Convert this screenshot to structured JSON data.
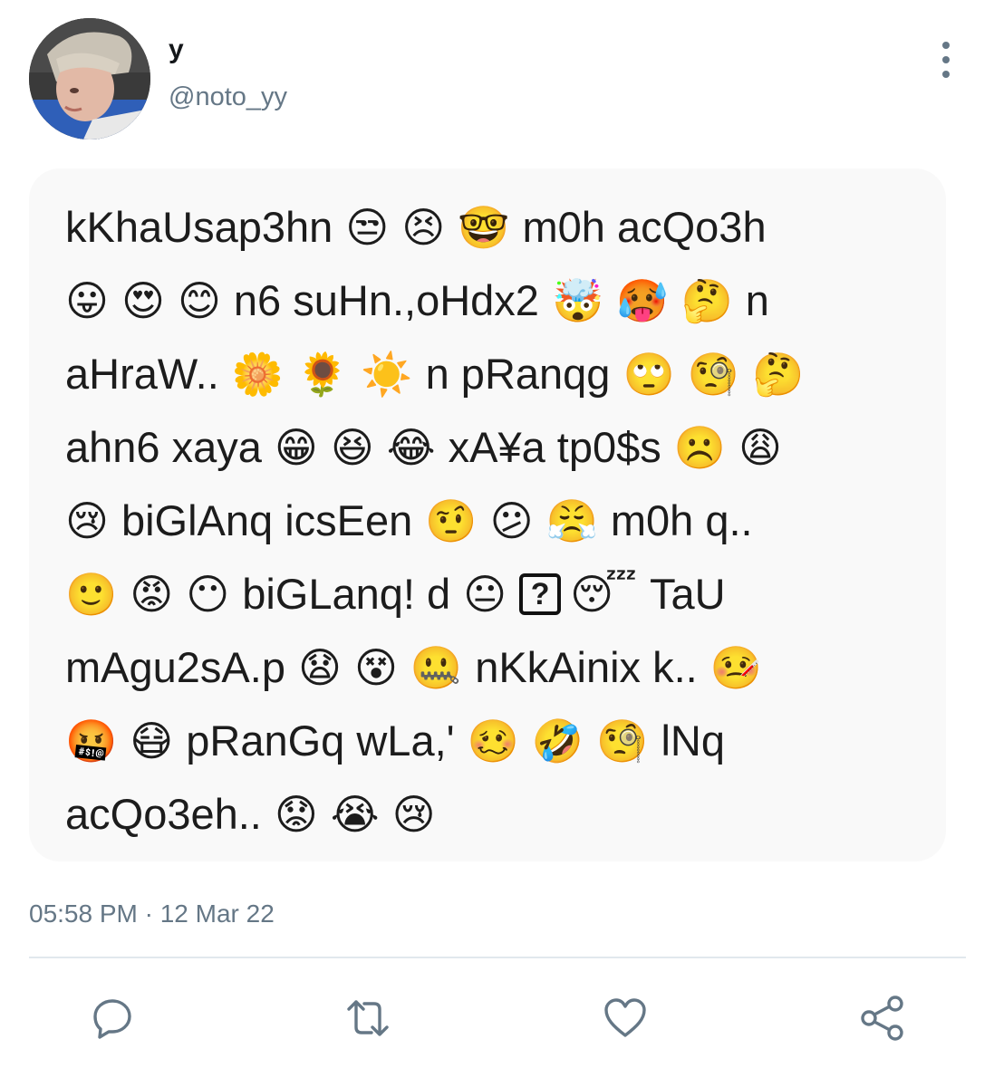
{
  "author": {
    "display_name": "y",
    "handle": "@noto_yy"
  },
  "tweet_image": {
    "lines": [
      [
        {
          "t": "w",
          "v": "kKhaUsap3hn"
        },
        {
          "t": "e",
          "v": "😒"
        },
        {
          "t": "e",
          "v": "😣"
        },
        {
          "t": "e",
          "v": "🤓"
        },
        {
          "t": "w",
          "v": "m0h acQo3h"
        }
      ],
      [
        {
          "t": "e",
          "v": "😛"
        },
        {
          "t": "e",
          "v": "😍"
        },
        {
          "t": "e",
          "v": "😊"
        },
        {
          "t": "w",
          "v": "n6 suHn.,oHdx2"
        },
        {
          "t": "e",
          "v": "🤯"
        },
        {
          "t": "e",
          "v": "🥵"
        },
        {
          "t": "e",
          "v": "🤔"
        },
        {
          "t": "w",
          "v": "n"
        }
      ],
      [
        {
          "t": "w",
          "v": "aHraW.."
        },
        {
          "t": "e",
          "v": "🌼"
        },
        {
          "t": "e",
          "v": "🌻"
        },
        {
          "t": "e",
          "v": "☀️"
        },
        {
          "t": "w",
          "v": "n pRanqg"
        },
        {
          "t": "e",
          "v": "🙄"
        },
        {
          "t": "e",
          "v": "🧐"
        },
        {
          "t": "e",
          "v": "🤔"
        }
      ],
      [
        {
          "t": "w",
          "v": "ahn6 xaya"
        },
        {
          "t": "e",
          "v": "😁"
        },
        {
          "t": "e",
          "v": "😆"
        },
        {
          "t": "e",
          "v": "😂"
        },
        {
          "t": "w",
          "v": "xA¥a tp0$s"
        },
        {
          "t": "e",
          "v": "☹️"
        },
        {
          "t": "e",
          "v": "😩"
        }
      ],
      [
        {
          "t": "e",
          "v": "😢"
        },
        {
          "t": "w",
          "v": "biGlAnq icsEen"
        },
        {
          "t": "e",
          "v": "🤨"
        },
        {
          "t": "e",
          "v": "😕"
        },
        {
          "t": "e",
          "v": "😤"
        },
        {
          "t": "w",
          "v": "m0h q.."
        }
      ],
      [
        {
          "t": "e",
          "v": "🙂"
        },
        {
          "t": "e",
          "v": "😡"
        },
        {
          "t": "e",
          "v": "😶"
        },
        {
          "t": "w",
          "v": "biGLanq! d"
        },
        {
          "t": "e",
          "v": "😐"
        },
        {
          "t": "b",
          "v": "?"
        },
        {
          "t": "e",
          "v": "😴"
        },
        {
          "t": "w",
          "v": "TaU"
        }
      ],
      [
        {
          "t": "w",
          "v": "mAgu2sA.p"
        },
        {
          "t": "e",
          "v": "😧"
        },
        {
          "t": "e",
          "v": "😵"
        },
        {
          "t": "e",
          "v": "🤐"
        },
        {
          "t": "w",
          "v": "nKkAinix k.."
        },
        {
          "t": "e",
          "v": "🤒"
        }
      ],
      [
        {
          "t": "e",
          "v": "🤬"
        },
        {
          "t": "e",
          "v": "😷"
        },
        {
          "t": "w",
          "v": "pRanGq wLa,'"
        },
        {
          "t": "e",
          "v": "🥴"
        },
        {
          "t": "e",
          "v": "🤣"
        },
        {
          "t": "e",
          "v": "🧐"
        },
        {
          "t": "w",
          "v": "lNq"
        }
      ],
      [
        {
          "t": "w",
          "v": "acQo3eh.."
        },
        {
          "t": "e",
          "v": "😟"
        },
        {
          "t": "e",
          "v": "😭"
        },
        {
          "t": "e",
          "v": "😢"
        }
      ]
    ]
  },
  "timestamp": "05:58 PM · 12 Mar 22",
  "actions": {
    "reply": "reply-icon",
    "retweet": "retweet-icon",
    "like": "heart-icon",
    "share": "share-icon"
  },
  "colors": {
    "text_primary": "#14171a",
    "text_secondary": "#657786",
    "divider": "#e1e8ed",
    "card_bg": "#f9f9f9"
  }
}
